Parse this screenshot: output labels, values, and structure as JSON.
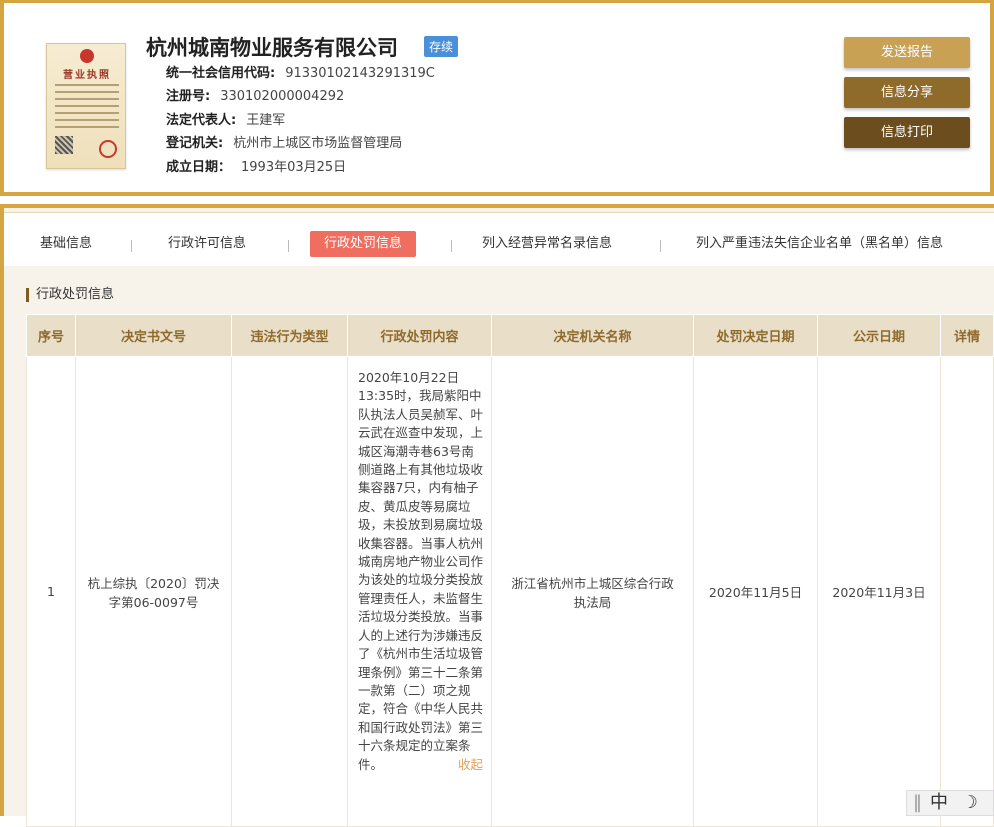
{
  "company": {
    "name": "杭州城南物业服务有限公司",
    "status": "存续",
    "license_title": "营业执照",
    "fields": [
      {
        "label": "统一社会信用代码:",
        "value": "91330102143291319C"
      },
      {
        "label": "注册号:",
        "value": "330102000004292"
      },
      {
        "label": "法定代表人:",
        "value": "王建军"
      },
      {
        "label": "登记机关:",
        "value": "杭州市上城区市场监督管理局"
      },
      {
        "label": "成立日期：",
        "value": "1993年03月25日"
      }
    ]
  },
  "buttons": {
    "report": "发送报告",
    "share": "信息分享",
    "print": "信息打印"
  },
  "tabs": [
    "基础信息",
    "行政许可信息",
    "行政处罚信息",
    "列入经营异常名录信息",
    "列入严重违法失信企业名单（黑名单）信息"
  ],
  "section_title": "行政处罚信息",
  "table": {
    "headers": [
      "序号",
      "决定书文号",
      "违法行为类型",
      "行政处罚内容",
      "决定机关名称",
      "处罚决定日期",
      "公示日期",
      "详情"
    ],
    "rows": [
      {
        "no": "1",
        "doc_no": "杭上综执〔2020〕罚决字第06-0097号",
        "type": "",
        "content": "2020年10月22日13:35时，我局紫阳中队执法人员吴赪军、叶云武在巡查中发现，上城区海潮寺巷63号南侧道路上有其他垃圾收集容器7只，内有柚子皮、黄瓜皮等易腐垃圾，未投放到易腐垃圾收集容器。当事人杭州城南房地产物业公司作为该处的垃圾分类投放管理责任人，未监督生活垃圾分类投放。当事人的上述行为涉嫌违反了《杭州市生活垃圾管理条例》第三十二条第一款第（二）项之规定，符合《中华人民共和国行政处罚法》第三十六条规定的立案条件。",
        "collapse": "收起",
        "authority": "浙江省杭州市上城区综合行政执法局",
        "decision_date": "2020年11月5日",
        "publish_date": "2020年11月3日",
        "detail": ""
      }
    ]
  },
  "widget": {
    "lang": "中",
    "moon": "☽"
  }
}
